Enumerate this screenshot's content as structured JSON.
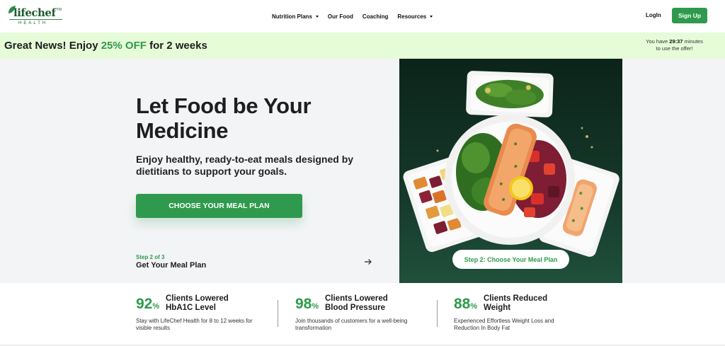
{
  "logo": {
    "name": "lifechef",
    "sub": "HEALTH",
    "tm": "TM"
  },
  "nav": {
    "items": [
      {
        "label": "Nutrition Plans",
        "has_menu": true
      },
      {
        "label": "Our Food",
        "has_menu": false
      },
      {
        "label": "Coaching",
        "has_menu": false
      },
      {
        "label": "Resources",
        "has_menu": true
      }
    ],
    "login_label": "LogIn",
    "signup_label": "Sign Up"
  },
  "promo": {
    "prefix": "Great News! Enjoy",
    "highlight": "25% OFF",
    "suffix": "for 2 weeks",
    "timer_prefix": "You have",
    "timer_value": "29:37",
    "timer_suffix": "minutes",
    "timer_line2": "to use the offer!"
  },
  "hero": {
    "title": "Let Food be Your Medicine",
    "subtitle": "Enjoy healthy, ready-to-eat meals designed by dietitians to support your goals.",
    "cta_label": "CHOOSE YOUR MEAL PLAN",
    "step_small": "Step 2 of 3",
    "step_title": "Get Your Meal Plan",
    "pill_label": "Step 2: Choose Your Meal Plan"
  },
  "stats": [
    {
      "num": "92",
      "pct": "%",
      "label_l1": "Clients Lowered",
      "label_l2": "HbA1C Level",
      "desc": "Stay with LifeChef Health for 8 to 12 weeks for visible results"
    },
    {
      "num": "98",
      "pct": "%",
      "label_l1": "Clients Lowered",
      "label_l2": "Blood Pressure",
      "desc": "Join thousands of customers for a well-being transformation"
    },
    {
      "num": "88",
      "pct": "%",
      "label_l1": "Clients Reduced",
      "label_l2": "Weight",
      "desc": "Experienced Effortless Weight Loss and Reduction In Body Fat"
    }
  ],
  "colors": {
    "brand_green": "#2f9a4d",
    "promo_bg": "#e6fbd8",
    "hero_bg": "#f3f4f6",
    "food_bg": "#15382a"
  }
}
